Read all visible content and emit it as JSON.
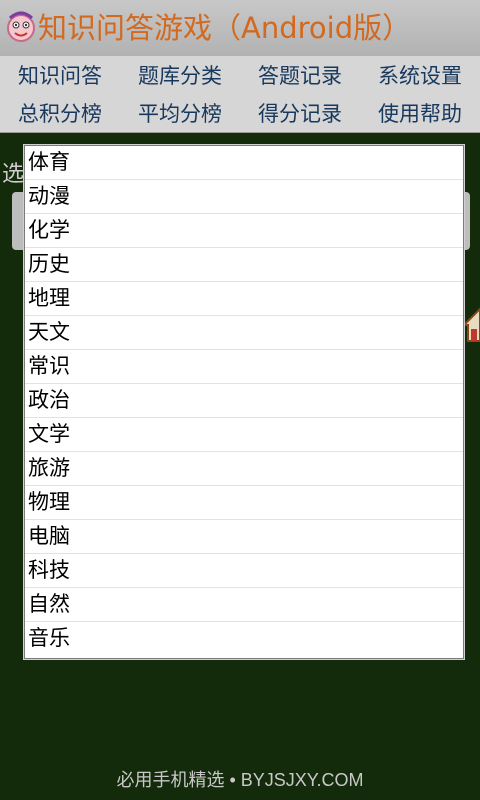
{
  "app": {
    "title": "知识问答游戏（Android版）"
  },
  "menu": {
    "row1": [
      "知识问答",
      "题库分类",
      "答题记录",
      "系统设置"
    ],
    "row2": [
      "总积分榜",
      "平均分榜",
      "得分记录",
      "使用帮助"
    ]
  },
  "background": {
    "label_partial": "选"
  },
  "category_list": {
    "items": [
      "体育",
      "动漫",
      "化学",
      "历史",
      "地理",
      "天文",
      "常识",
      "政治",
      "文学",
      "旅游",
      "物理",
      "电脑",
      "科技",
      "自然",
      "音乐"
    ]
  },
  "watermark": "必用手机精选 • BYJSJXY.COM",
  "colors": {
    "title": "#d2691e",
    "menu_text": "#18385e",
    "screen_bg": "#132a0b"
  },
  "icons": {
    "app": "cartoon-face-icon",
    "house": "house-icon"
  }
}
